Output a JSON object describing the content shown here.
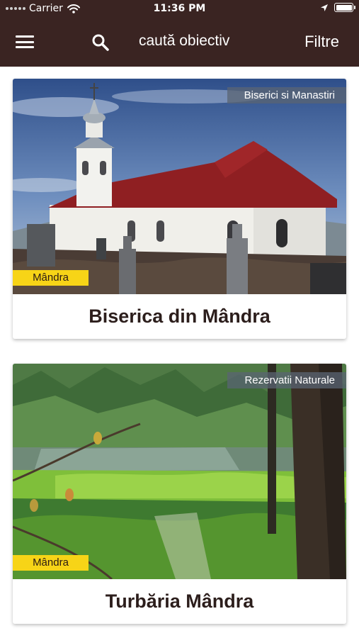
{
  "status_bar": {
    "carrier": "Carrier",
    "time": "11:36 PM"
  },
  "nav": {
    "menu_icon": "hamburger-menu-icon",
    "search_icon": "search-icon",
    "search_placeholder": "caută obiectiv",
    "filter_label": "Filtre"
  },
  "colors": {
    "header_bg": "#3a2422",
    "place_badge_bg": "#f7d417",
    "title_text": "#2c1e1c"
  },
  "cards": [
    {
      "title": "Biserica din Mândra",
      "category": "Biserici si Manastiri",
      "location": "Mândra",
      "image": "church-photo"
    },
    {
      "title": "Turbăria Mândra",
      "category": "Rezervatii Naturale",
      "location": "Mândra",
      "image": "peat-bog-photo"
    }
  ]
}
